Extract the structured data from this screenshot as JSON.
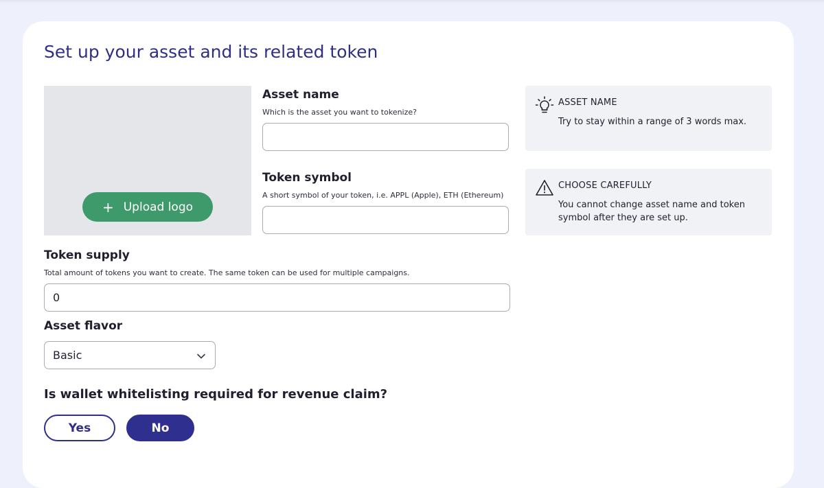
{
  "page": {
    "title": "Set up your asset and its related token"
  },
  "logo": {
    "upload_label": "Upload logo"
  },
  "asset_name": {
    "label": "Asset name",
    "hint": "Which is the asset you want to tokenize?",
    "value": ""
  },
  "token_symbol": {
    "label": "Token symbol",
    "hint": "A short symbol of your token, i.e. APPL (Apple), ETH (Ethereum)",
    "value": ""
  },
  "token_supply": {
    "label": "Token supply",
    "hint": "Total amount of tokens you want to create. The same token can be used for multiple campaigns.",
    "value": "0"
  },
  "asset_flavor": {
    "label": "Asset flavor",
    "selected": "Basic"
  },
  "whitelisting": {
    "question": "Is wallet whitelisting required for revenue claim?",
    "yes_label": "Yes",
    "no_label": "No",
    "selected": "No"
  },
  "tips": [
    {
      "icon": "lightbulb-icon",
      "title": "ASSET NAME",
      "text": "Try to stay within a range of 3 words max."
    },
    {
      "icon": "warning-icon",
      "title": "CHOOSE CAREFULLY",
      "text": "You cannot change asset name and token symbol after they are set up."
    }
  ],
  "colors": {
    "background": "#eef0fb",
    "primary": "#2f2f8f",
    "upload_button": "#3f9a6b",
    "tip_background": "#f1f2f5"
  }
}
